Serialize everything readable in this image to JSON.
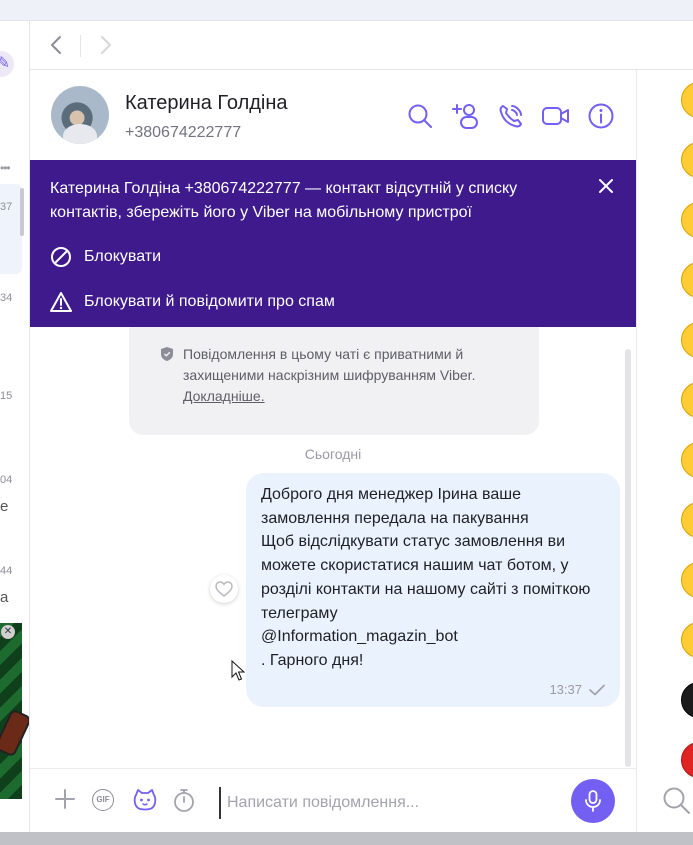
{
  "sidebar": {
    "times": [
      "37",
      "34",
      "15",
      "04",
      "44"
    ],
    "snippets": [
      "e",
      "a"
    ]
  },
  "nav": {
    "back_icon": "chevron-left-icon",
    "forward_icon": "chevron-right-icon"
  },
  "contact": {
    "name": "Катерина Голдіна",
    "phone": "+380674222777"
  },
  "header_icons": [
    "search-icon",
    "add-participant-icon",
    "voice-call-icon",
    "video-call-icon",
    "info-icon"
  ],
  "banner": {
    "text": "Катерина Голдіна +380674222777 — контакт відсутній у списку контактів, збережіть його у Viber на мобільному пристрої",
    "block_label": "Блокувати",
    "block_report_label": "Блокувати й повідомити про спам"
  },
  "encryption": {
    "text": "Повідомлення в цьому чаті є приватними й захищеними наскрізним шифруванням Viber.",
    "link": "Докладніше."
  },
  "date_separator": "Сьогодні",
  "message": {
    "text": "Доброго дня менеджер Ірина ваше замовлення передала на пакування\nЩоб відслідкувати статус замовлення ви можете скористатися нашим чат ботом, у розділі контакти на нашому сайті з поміткою телеграму\n@Information_magazin_bot\n. Гарного дня!",
    "time": "13:37",
    "status": "sent"
  },
  "composer": {
    "placeholder": "Написати повідомлення...",
    "gif_label": "GIF"
  },
  "colors": {
    "accent": "#7360f2",
    "banner": "#3e1a8c",
    "bubble": "#eaf2fd"
  }
}
